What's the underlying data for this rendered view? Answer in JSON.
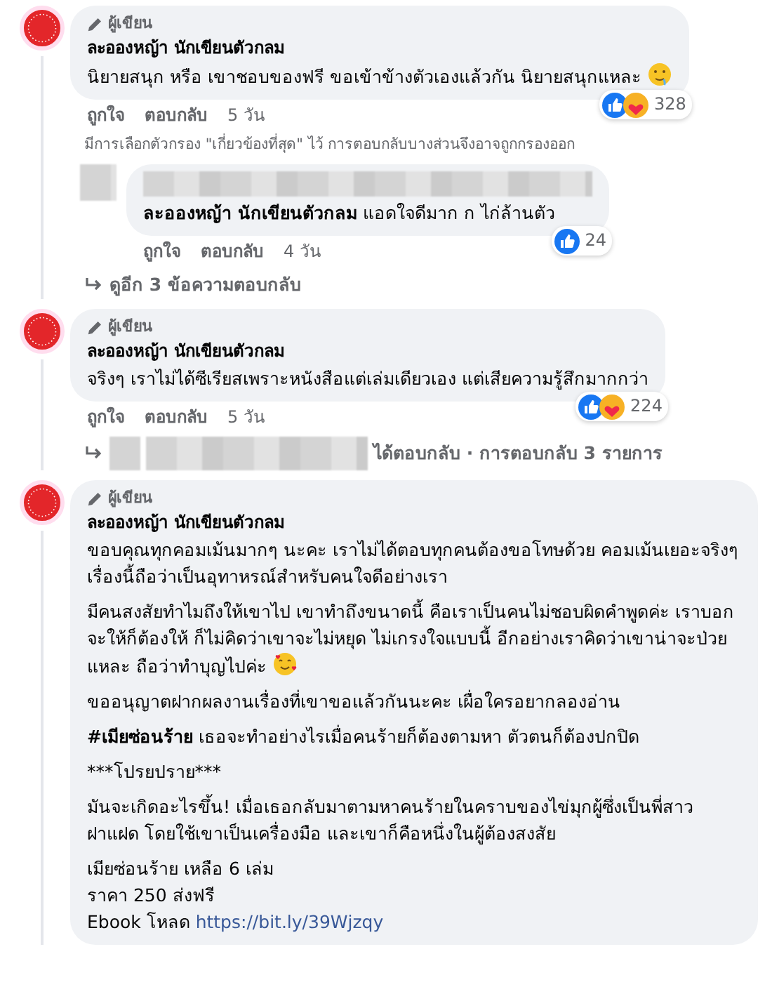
{
  "comments": [
    {
      "badge": "ผู้เขียน",
      "author": "ละอองหญ้า นักเขียนตัวกลม",
      "paragraphs": [
        {
          "text": "นิยายสนุก หรือ เขาชอบของฟรี ขอเข้าข้างตัวเองแล้วกัน นิยายสนุกแหละ",
          "emoji": {
            "kind": "drool"
          }
        }
      ],
      "reactions": {
        "icons": [
          {
            "kind": "like"
          },
          {
            "kind": "care"
          }
        ],
        "count": "328"
      },
      "actions": [
        "ถูกใจ",
        "ตอบกลับ"
      ],
      "time": "5 วัน",
      "filter_note": "มีการเลือกตัวกรอง \"เกี่ยวข้องที่สุด\" ไว้ การตอบกลับบางส่วนจึงอาจถูกกรองออก",
      "replies": [
        {
          "mention": "ละอองหญ้า นักเขียนตัวกลม",
          "text": " แอดใจดีมาก ก ไก่ล้านตัว",
          "reactions": {
            "icons": [
              {
                "kind": "like"
              }
            ],
            "count": "24"
          },
          "actions": [
            "ถูกใจ",
            "ตอบกลับ"
          ],
          "time": "4 วัน"
        }
      ],
      "more_replies": "ดูอีก 3 ข้อความตอบกลับ"
    },
    {
      "badge": "ผู้เขียน",
      "author": "ละอองหญ้า นักเขียนตัวกลม",
      "paragraphs": [
        {
          "text": "จริงๆ เราไม่ได้ซีเรียสเพราะหนังสือแต่เล่มเดียวเอง แต่เสียความรู้สึกมากกว่า"
        }
      ],
      "reactions": {
        "icons": [
          {
            "kind": "like"
          },
          {
            "kind": "care"
          }
        ],
        "count": "224"
      },
      "actions": [
        "ถูกใจ",
        "ตอบกลับ"
      ],
      "time": "5 วัน",
      "reply_summary": "ได้ตอบกลับ · การตอบกลับ 3 รายการ"
    },
    {
      "badge": "ผู้เขียน",
      "author": "ละอองหญ้า นักเขียนตัวกลม",
      "paragraphs": [
        {
          "text": "ขอบคุณทุกคอมเม้นมากๆ นะคะ เราไม่ได้ตอบทุกคนต้องขอโทษด้วย คอมเม้นเยอะจริงๆ เรื่องนี้ถือว่าเป็นอุทาหรณ์สำหรับคนใจดีอย่างเรา"
        },
        {
          "text": "มีคนสงสัยทำไมถึงให้เขาไป เขาทำถึงขนาดนี้ คือเราเป็นคนไม่ชอบผิดคำพูดค่ะ เราบอกจะให้ก็ต้องให้ ก็ไม่คิดว่าเขาจะไม่หยุด ไม่เกรงใจแบบนี้ อีกอย่างเราคิดว่าเขาน่าจะป่วยแหละ ถือว่าทำบุญไปค่ะ",
          "emoji": {
            "kind": "love"
          }
        },
        {
          "text": "ขออนุญาตฝากผลงานเรื่องที่เขาขอแล้วกันนะคะ เผื่อใครอยากลองอ่าน"
        },
        {
          "hashtag": "#เมียซ่อนร้าย",
          "text": " เธอจะทำอย่างไรเมื่อคนร้ายก็ต้องตามหา ตัวตนก็ต้องปกปิด"
        },
        {
          "text": "***โปรยปราย***"
        },
        {
          "text": "มันจะเกิดอะไรขึ้น! เมื่อเธอกลับมาตามหาคนร้ายในคราบของไข่มุกผู้ซึ่งเป็นพี่สาวฝาแฝด โดยใช้เขาเป็นเครื่องมือ และเขาก็คือหนึ่งในผู้ต้องสงสัย"
        },
        {
          "text": "เมียซ่อนร้าย เหลือ 6 เล่ม\nราคา 250 ส่งฟรี\nEbook โหลด",
          "link": "https://bit.ly/39Wjzqy"
        }
      ]
    }
  ]
}
